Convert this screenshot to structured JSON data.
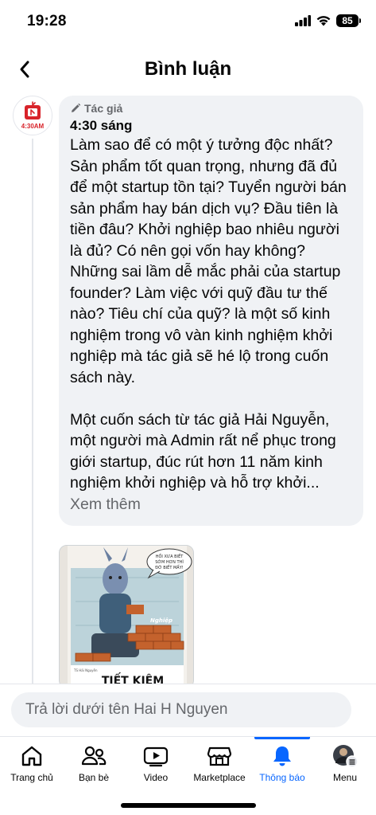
{
  "status_bar": {
    "time": "19:28",
    "battery": "85"
  },
  "header": {
    "title": "Bình luận"
  },
  "page": {
    "avatar_label": "4:30AM"
  },
  "comment": {
    "author_badge": "Tác giả",
    "time": "4:30 sáng",
    "paragraph1": "Làm sao để có một ý tưởng độc nhất? Sản phẩm tốt quan trọng, nhưng đã đủ để một startup tồn tại? Tuyển người bán sản phẩm hay bán dịch vụ? Đầu tiên là tiền đâu? Khởi nghiệp bao nhiêu người là đủ? Có nên gọi vốn hay không? Những sai lầm dễ mắc phải của startup founder? Làm việc với quỹ đầu tư thế nào? Tiêu chí của quỹ? là một số kinh nghiệm trong vô vàn kinh nghiệm khởi nghiệp mà tác giả sẽ hé lộ trong cuốn sách này.",
    "paragraph2": "Một cuốn sách từ tác giả Hải Nguyễn, một người mà Admin rất nể phục trong giới startup, đúc rút hơn 11 năm kinh nghiệm khởi nghiệp và hỗ trợ khởi...",
    "see_more": "Xem thêm"
  },
  "book": {
    "speech": "HỒI XƯA BIẾT SỚM HƠN THÌ ĐỠ BIẾT MẤY!",
    "title": "TIẾT KIỆM",
    "author": "TS Hải Nguyễn"
  },
  "reply": {
    "placeholder": "Trả lời dưới tên Hai H Nguyen"
  },
  "tabs": [
    {
      "label": "Trang chủ",
      "icon": "home-icon"
    },
    {
      "label": "Bạn bè",
      "icon": "friends-icon"
    },
    {
      "label": "Video",
      "icon": "video-icon"
    },
    {
      "label": "Marketplace",
      "icon": "marketplace-icon"
    },
    {
      "label": "Thông báo",
      "icon": "bell-icon",
      "active": true
    },
    {
      "label": "Menu",
      "icon": "menu-avatar-icon"
    }
  ],
  "colors": {
    "accent": "#0866ff",
    "bubble": "#f0f2f5",
    "muted": "#65676b",
    "brand_red": "#d8232a"
  }
}
